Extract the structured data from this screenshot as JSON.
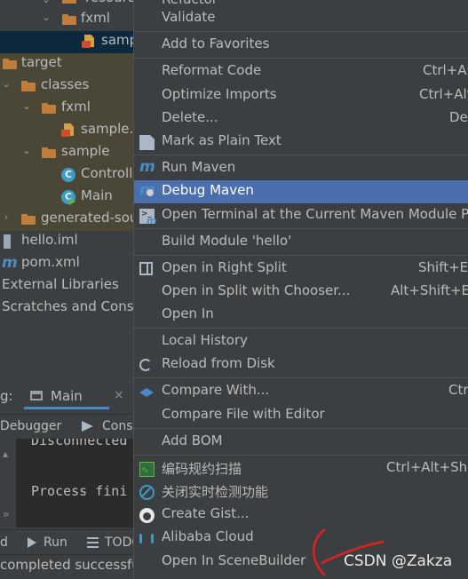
{
  "tree": {
    "rows": [
      {
        "label": "resources",
        "kind": "folder"
      },
      {
        "label": "fxml",
        "kind": "folder"
      },
      {
        "label": "samp",
        "kind": "fxml-file"
      },
      {
        "label": "target",
        "kind": "folder"
      },
      {
        "label": "classes",
        "kind": "folder"
      },
      {
        "label": "fxml",
        "kind": "folder"
      },
      {
        "label": "sample.f",
        "kind": "fxml-file"
      },
      {
        "label": "sample",
        "kind": "folder"
      },
      {
        "label": "Controll",
        "kind": "class"
      },
      {
        "label": "Main",
        "kind": "class"
      },
      {
        "label": "generated-sou",
        "kind": "folder"
      },
      {
        "label": "hello.iml",
        "kind": "iml-file"
      },
      {
        "label": "pom.xml",
        "kind": "maven-file"
      },
      {
        "label": "External Libraries",
        "kind": "libraries"
      },
      {
        "label": "Scratches and Conso",
        "kind": "scratches"
      }
    ]
  },
  "run_panel": {
    "prefix": "g:",
    "tab_label": "Main",
    "close": "×",
    "subtab_debugger": "Debugger",
    "subtab_console": "Conso",
    "console_line_1": "Disconnected",
    "console_line_2": "Process fini",
    "gutter_more": "»"
  },
  "bottom_toolbar": {
    "left_partial": "d",
    "run_label": "Run",
    "todo_label": "TODO"
  },
  "status_bar": {
    "text": "completed successful"
  },
  "context_menu": {
    "items": [
      {
        "label": "Refactor",
        "shortcut": ""
      },
      {
        "label": "Validate",
        "shortcut": ""
      },
      {
        "label": "Add to Favorites",
        "shortcut": ""
      },
      {
        "label": "Reformat Code",
        "shortcut": "Ctrl+Al"
      },
      {
        "label": "Optimize Imports",
        "shortcut": "Ctrl+Alt"
      },
      {
        "label": "Delete...",
        "shortcut": "Del"
      },
      {
        "label": "Mark as Plain Text",
        "shortcut": ""
      },
      {
        "label": "Run Maven",
        "shortcut": ""
      },
      {
        "label": "Debug Maven",
        "shortcut": ""
      },
      {
        "label": "Open Terminal at the Current Maven Module Pa",
        "shortcut": ""
      },
      {
        "label": "Build Module 'hello'",
        "shortcut": ""
      },
      {
        "label": "Open in Right Split",
        "shortcut": "Shift+En"
      },
      {
        "label": "Open in Split with Chooser...",
        "shortcut": "Alt+Shift+En"
      },
      {
        "label": "Open In",
        "shortcut": ""
      },
      {
        "label": "Local History",
        "shortcut": ""
      },
      {
        "label": "Reload from Disk",
        "shortcut": ""
      },
      {
        "label": "Compare With...",
        "shortcut": "Ctr"
      },
      {
        "label": "Compare File with Editor",
        "shortcut": ""
      },
      {
        "label": "Add BOM",
        "shortcut": ""
      },
      {
        "label": "编码规约扫描",
        "shortcut": "Ctrl+Alt+Shi"
      },
      {
        "label": "关闭实时检测功能",
        "shortcut": ""
      },
      {
        "label": "Create Gist...",
        "shortcut": ""
      },
      {
        "label": "Alibaba Cloud",
        "shortcut": ""
      },
      {
        "label": "Open In SceneBuilder",
        "shortcut": ""
      }
    ],
    "highlighted": "Debug Maven"
  },
  "watermark": "CSDN @Zakza",
  "colors": {
    "background": "#3c3f41",
    "highlight": "#4b6eaf",
    "folder": "#c07d3b",
    "folder_dim": "#8a6a3b",
    "text": "#bbbbbb"
  }
}
